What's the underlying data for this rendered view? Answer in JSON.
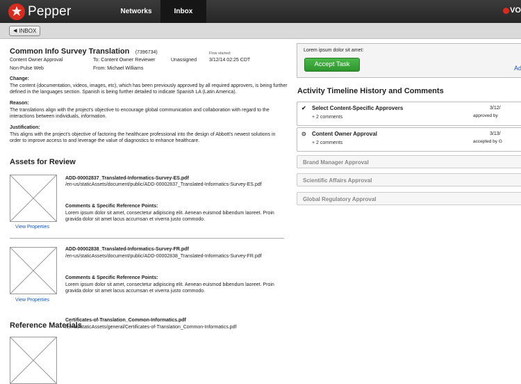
{
  "header": {
    "logo_text": "Pepper",
    "nav": [
      "Networks",
      "Inbox"
    ],
    "brand_right": "VO",
    "brand_color": "#d62b1f"
  },
  "subbar": {
    "back_label": "INBOX"
  },
  "document": {
    "title": "Common Info Survey Translation",
    "id": "(7396734)",
    "status_left": "Content Owner Approval",
    "network": "Non-Pulse Web",
    "to": "To: Content Owner Reviewer",
    "from": "From: Michael Williams",
    "assignee": "Unassigned",
    "flow_started_label": "Flow started:",
    "flow_started": "3/12/14  02:25 CDT",
    "change_label": "Change:",
    "change_text": "The content (documentation, videos, images, etc), which has been previously approved by all required approvers, is being further defined in the languages section.  Spanish is being further detailed to indicate Spanish LA (Latin America).",
    "reason_label": "Reason:",
    "reason_text": "The translations align with the project's objective to encourage global communication and collaboration with regard to the interactions between individuals, information.",
    "justification_label": "Justification:",
    "justification_text": "This aligns with the project's objective of factoring the healthcare professional into the design of Abbott's newest solutions in order to improve access to and leverage the value of diagnostics to enhance healthcare."
  },
  "assets": {
    "heading": "Assets for Review",
    "items": [
      {
        "file": "ADD-00002837_Translated-Informatics-Survey-ES.pdf",
        "path": "/en-us/staticAssets/document/public/ADD-00002837_Translated-Informatics-Survey-ES.pdf",
        "comments_label": "Comments & Specific Reference Points:",
        "comments": "Lorem ipsum dolor sit amet, consectetur adipiscing elit. Aenean euismod bibendum laoreet. Proin gravida dolor sit amet lacus accumsan et viverra justo commodo.",
        "view": "View Properties"
      },
      {
        "file": "ADD-00002838_Translated-Informatics-Survey-FR.pdf",
        "path": "/en-us/staticAssets/document/public/ADD-00002838_Translated-Informatics-Survey-FR.pdf",
        "comments_label": "Comments & Specific Reference Points:",
        "comments": "Lorem ipsum dolor sit amet, consectetur adipiscing elit. Aenean euismod bibendum laoreet. Proin gravida dolor sit amet lacus accumsan et viverra justo commodo.",
        "view": "View Properties"
      }
    ]
  },
  "references": {
    "heading": "Reference Materials",
    "items": [
      {
        "file": "Certificates-of-Translation_Common-Informatics.pdf",
        "path": "/en-us/staticAssets/general/Certificates-of-Translation_Common-Informatics.pdf"
      }
    ]
  },
  "task": {
    "text": "Lorem ipsum dolor sit amet:",
    "accept_label": "Accept Task",
    "add_link": "Add",
    "accent": "#2d952d"
  },
  "timeline": {
    "title": "Activity Timeline History and Comments",
    "items": [
      {
        "icon": "check-icon",
        "name": "Select Content-Specific Approvers",
        "comments": "+ 2 comments",
        "date": "3/12/",
        "status": "approved by"
      },
      {
        "icon": "clock-icon",
        "name": "Content Owner Approval",
        "comments": "+ 2 comments",
        "date": "3/13/",
        "status": "accepted by G"
      }
    ],
    "pending": [
      "Brand Manager Approval",
      "Scientific Affairs Approval",
      "Global Regulatory Approval"
    ]
  }
}
